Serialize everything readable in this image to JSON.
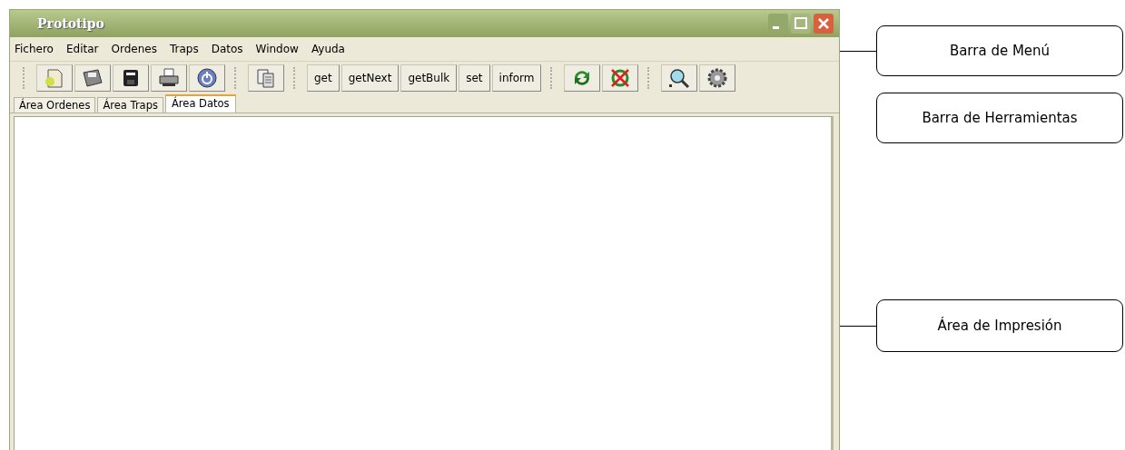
{
  "window": {
    "title": "Prototipo"
  },
  "menu": [
    "Fichero",
    "Editar",
    "Ordenes",
    "Traps",
    "Datos",
    "Window",
    "Ayuda"
  ],
  "toolbar_text_buttons": [
    "get",
    "getNext",
    "getBulk",
    "set",
    "inform"
  ],
  "tabs": [
    {
      "label": "Área Ordenes",
      "selected": false
    },
    {
      "label": "Área Traps",
      "selected": false
    },
    {
      "label": "Área Datos",
      "selected": true
    }
  ],
  "callouts": [
    {
      "label": "Barra de Menú",
      "leader": true
    },
    {
      "label": "Barra de Herramientas",
      "leader": false
    },
    {
      "label": "Área de Impresión",
      "leader": true
    }
  ]
}
